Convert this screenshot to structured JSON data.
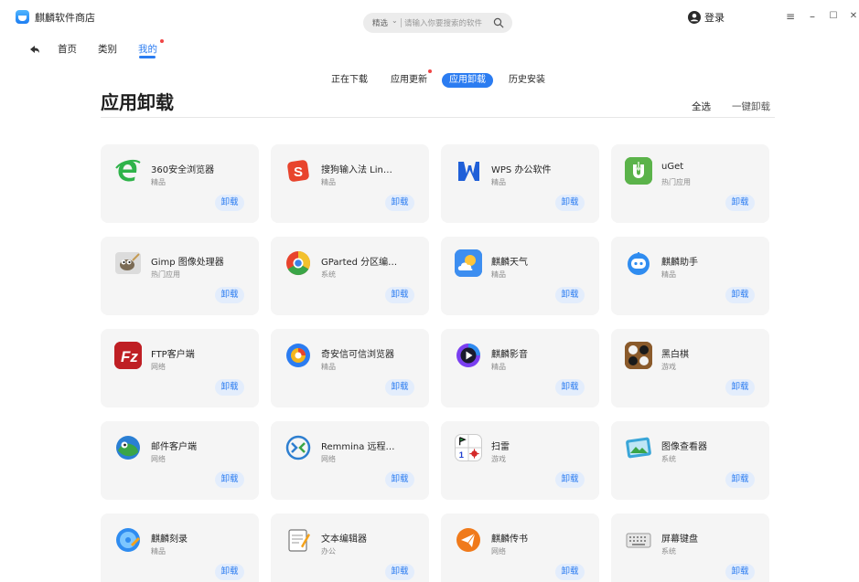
{
  "window": {
    "title": "麒麟软件商店",
    "controls": {
      "menu": "≡",
      "minimize": "–",
      "maximize": "☐",
      "close": "✕"
    }
  },
  "search": {
    "scope": "精选",
    "placeholder": "请输入你要搜索的软件"
  },
  "account": {
    "login_label": "登录"
  },
  "nav": {
    "items": [
      "首页",
      "类别",
      "我的"
    ],
    "active": "我的"
  },
  "subtabs": {
    "items": [
      "正在下载",
      "应用更新",
      "应用卸载",
      "历史安装"
    ],
    "active": "应用卸载"
  },
  "page": {
    "title": "应用卸载",
    "select_all": "全选",
    "uninstall_all": "一键卸载"
  },
  "colors": {
    "accent": "#2b7cf1",
    "badge": "#f04545"
  },
  "uninstall_label": "卸载",
  "apps": [
    {
      "name": "360安全浏览器",
      "category": "精品",
      "icon": "browser-360-icon"
    },
    {
      "name": "搜狗输入法 Lin…",
      "category": "精品",
      "icon": "sogou-icon"
    },
    {
      "name": "WPS 办公软件",
      "category": "精品",
      "icon": "wps-icon"
    },
    {
      "name": "uGet",
      "category": "热门应用",
      "icon": "uget-icon"
    },
    {
      "name": "Gimp 图像处理器",
      "category": "热门应用",
      "icon": "gimp-icon"
    },
    {
      "name": "GParted 分区编…",
      "category": "系统",
      "icon": "gparted-icon"
    },
    {
      "name": "麒麟天气",
      "category": "精品",
      "icon": "weather-icon"
    },
    {
      "name": "麒麟助手",
      "category": "精品",
      "icon": "assistant-icon"
    },
    {
      "name": "FTP客户端",
      "category": "网络",
      "icon": "filezilla-icon"
    },
    {
      "name": "奇安信可信浏览器",
      "category": "精品",
      "icon": "qianxin-browser-icon"
    },
    {
      "name": "麒麟影音",
      "category": "精品",
      "icon": "video-player-icon"
    },
    {
      "name": "黑白棋",
      "category": "游戏",
      "icon": "reversi-icon"
    },
    {
      "name": "邮件客户端",
      "category": "网络",
      "icon": "mail-client-icon"
    },
    {
      "name": "Remmina 远程…",
      "category": "网络",
      "icon": "remmina-icon"
    },
    {
      "name": "扫雷",
      "category": "游戏",
      "icon": "minesweeper-icon"
    },
    {
      "name": "图像查看器",
      "category": "系统",
      "icon": "image-viewer-icon"
    },
    {
      "name": "麒麟刻录",
      "category": "精品",
      "icon": "burner-icon"
    },
    {
      "name": "文本编辑器",
      "category": "办公",
      "icon": "text-editor-icon"
    },
    {
      "name": "麒麟传书",
      "category": "网络",
      "icon": "transfer-icon"
    },
    {
      "name": "屏幕键盘",
      "category": "系统",
      "icon": "onscreen-keyboard-icon"
    }
  ]
}
